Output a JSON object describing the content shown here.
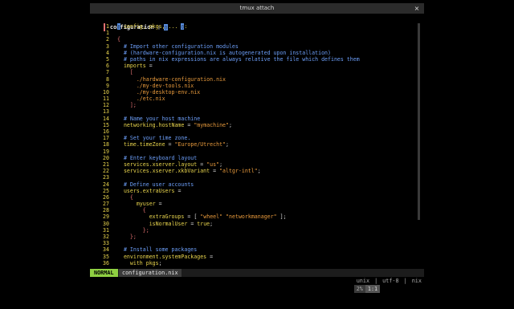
{
  "window": {
    "title": "tmux attach",
    "close_glyph": "×"
  },
  "tabline": {
    "active_tab": "configuration",
    "tab_box": "▯",
    "cursor_box": "▯"
  },
  "editor": {
    "lines": [
      {
        "n": "1",
        "text": "▯ config, pkgs, ... ▯:",
        "kind": "first"
      },
      {
        "n": "1",
        "text": "",
        "kind": "text"
      },
      {
        "n": "2",
        "text": "{",
        "kind": "bracket"
      },
      {
        "n": "3",
        "text": "  # Import other configuration modules",
        "kind": "comment"
      },
      {
        "n": "4",
        "text": "  # (hardware-configuration.nix is autogenerated upon installation)",
        "kind": "comment"
      },
      {
        "n": "5",
        "text": "  # paths in nix expressions are always relative the file which defines them",
        "kind": "comment"
      },
      {
        "n": "6",
        "text": "  imports =",
        "kind": "key"
      },
      {
        "n": "7",
        "text": "    [",
        "kind": "bracket"
      },
      {
        "n": "8",
        "text": "      ./hardware-configuration.nix",
        "kind": "path"
      },
      {
        "n": "9",
        "text": "      ./my-dev-tools.nix",
        "kind": "path"
      },
      {
        "n": "10",
        "text": "      ./my-desktop-env.nix",
        "kind": "path"
      },
      {
        "n": "11",
        "text": "      ./etc.nix",
        "kind": "path"
      },
      {
        "n": "12",
        "text": "    ];",
        "kind": "bracket"
      },
      {
        "n": "13",
        "text": "",
        "kind": "text"
      },
      {
        "n": "14",
        "text": "  # Name your host machine",
        "kind": "comment"
      },
      {
        "n": "15",
        "text": "  networking.hostName = \"mymachine\";",
        "kind": "assign"
      },
      {
        "n": "16",
        "text": "",
        "kind": "text"
      },
      {
        "n": "17",
        "text": "  # Set your time zone.",
        "kind": "comment"
      },
      {
        "n": "18",
        "text": "  time.timeZone = \"Europe/Utrecht\";",
        "kind": "assign"
      },
      {
        "n": "19",
        "text": "",
        "kind": "text"
      },
      {
        "n": "20",
        "text": "  # Enter keyboard layout",
        "kind": "comment"
      },
      {
        "n": "21",
        "text": "  services.xserver.layout = \"us\";",
        "kind": "assign"
      },
      {
        "n": "22",
        "text": "  services.xserver.xkbVariant = \"altgr-intl\";",
        "kind": "assign"
      },
      {
        "n": "23",
        "text": "",
        "kind": "text"
      },
      {
        "n": "24",
        "text": "  # Define user accounts",
        "kind": "comment"
      },
      {
        "n": "25",
        "text": "  users.extraUsers =",
        "kind": "key"
      },
      {
        "n": "26",
        "text": "    {",
        "kind": "bracket"
      },
      {
        "n": "27",
        "text": "      myuser =",
        "kind": "key"
      },
      {
        "n": "28",
        "text": "        {",
        "kind": "bracket"
      },
      {
        "n": "29",
        "text": "          extraGroups = [ \"wheel\" \"networkmanager\" ];",
        "kind": "assign"
      },
      {
        "n": "30",
        "text": "          isNormalUser = true;",
        "kind": "assign"
      },
      {
        "n": "31",
        "text": "        };",
        "kind": "bracket"
      },
      {
        "n": "32",
        "text": "    };",
        "kind": "bracket"
      },
      {
        "n": "33",
        "text": "",
        "kind": "text"
      },
      {
        "n": "34",
        "text": "  # Install some packages",
        "kind": "comment"
      },
      {
        "n": "35",
        "text": "  environment.systemPackages =",
        "kind": "key"
      },
      {
        "n": "36",
        "text": "    with pkgs;",
        "kind": "key"
      }
    ]
  },
  "statusbar": {
    "mode": "NORMAL",
    "filename": "configuration.nix",
    "fileformat": "unix",
    "encoding": "utf-8",
    "filetype": "nix",
    "percent": "2%",
    "position": "1:1"
  },
  "colors": {
    "comment": "#6c9ef8",
    "keyword": "#e8d44d",
    "string": "#e89a3c",
    "bracket": "#e07070",
    "mode_bg": "#8fd042"
  }
}
